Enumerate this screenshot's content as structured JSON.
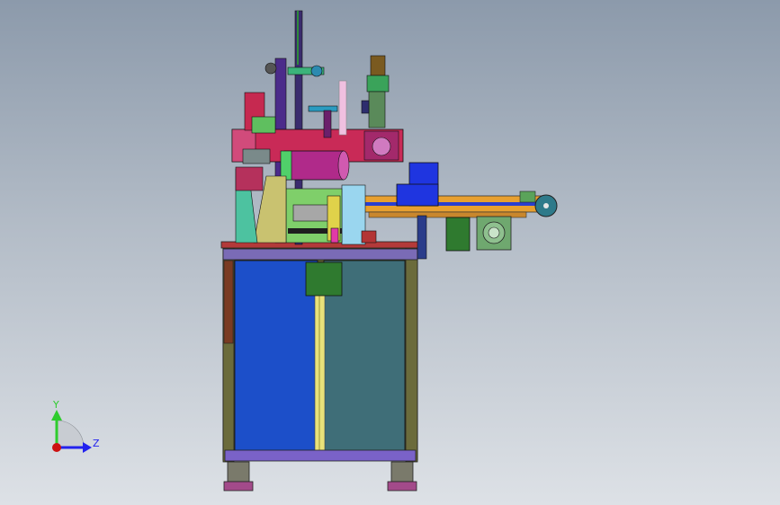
{
  "viewport": {
    "background_top": "#8c9aab",
    "background_bottom": "#dde1e6"
  },
  "model": {
    "subject": "assembly-machine-side-view"
  },
  "triad": {
    "y_label": "Y",
    "z_label": "Z",
    "y_color": "#2ecc2e",
    "z_color": "#2222ee",
    "origin_color": "#cc1111"
  }
}
